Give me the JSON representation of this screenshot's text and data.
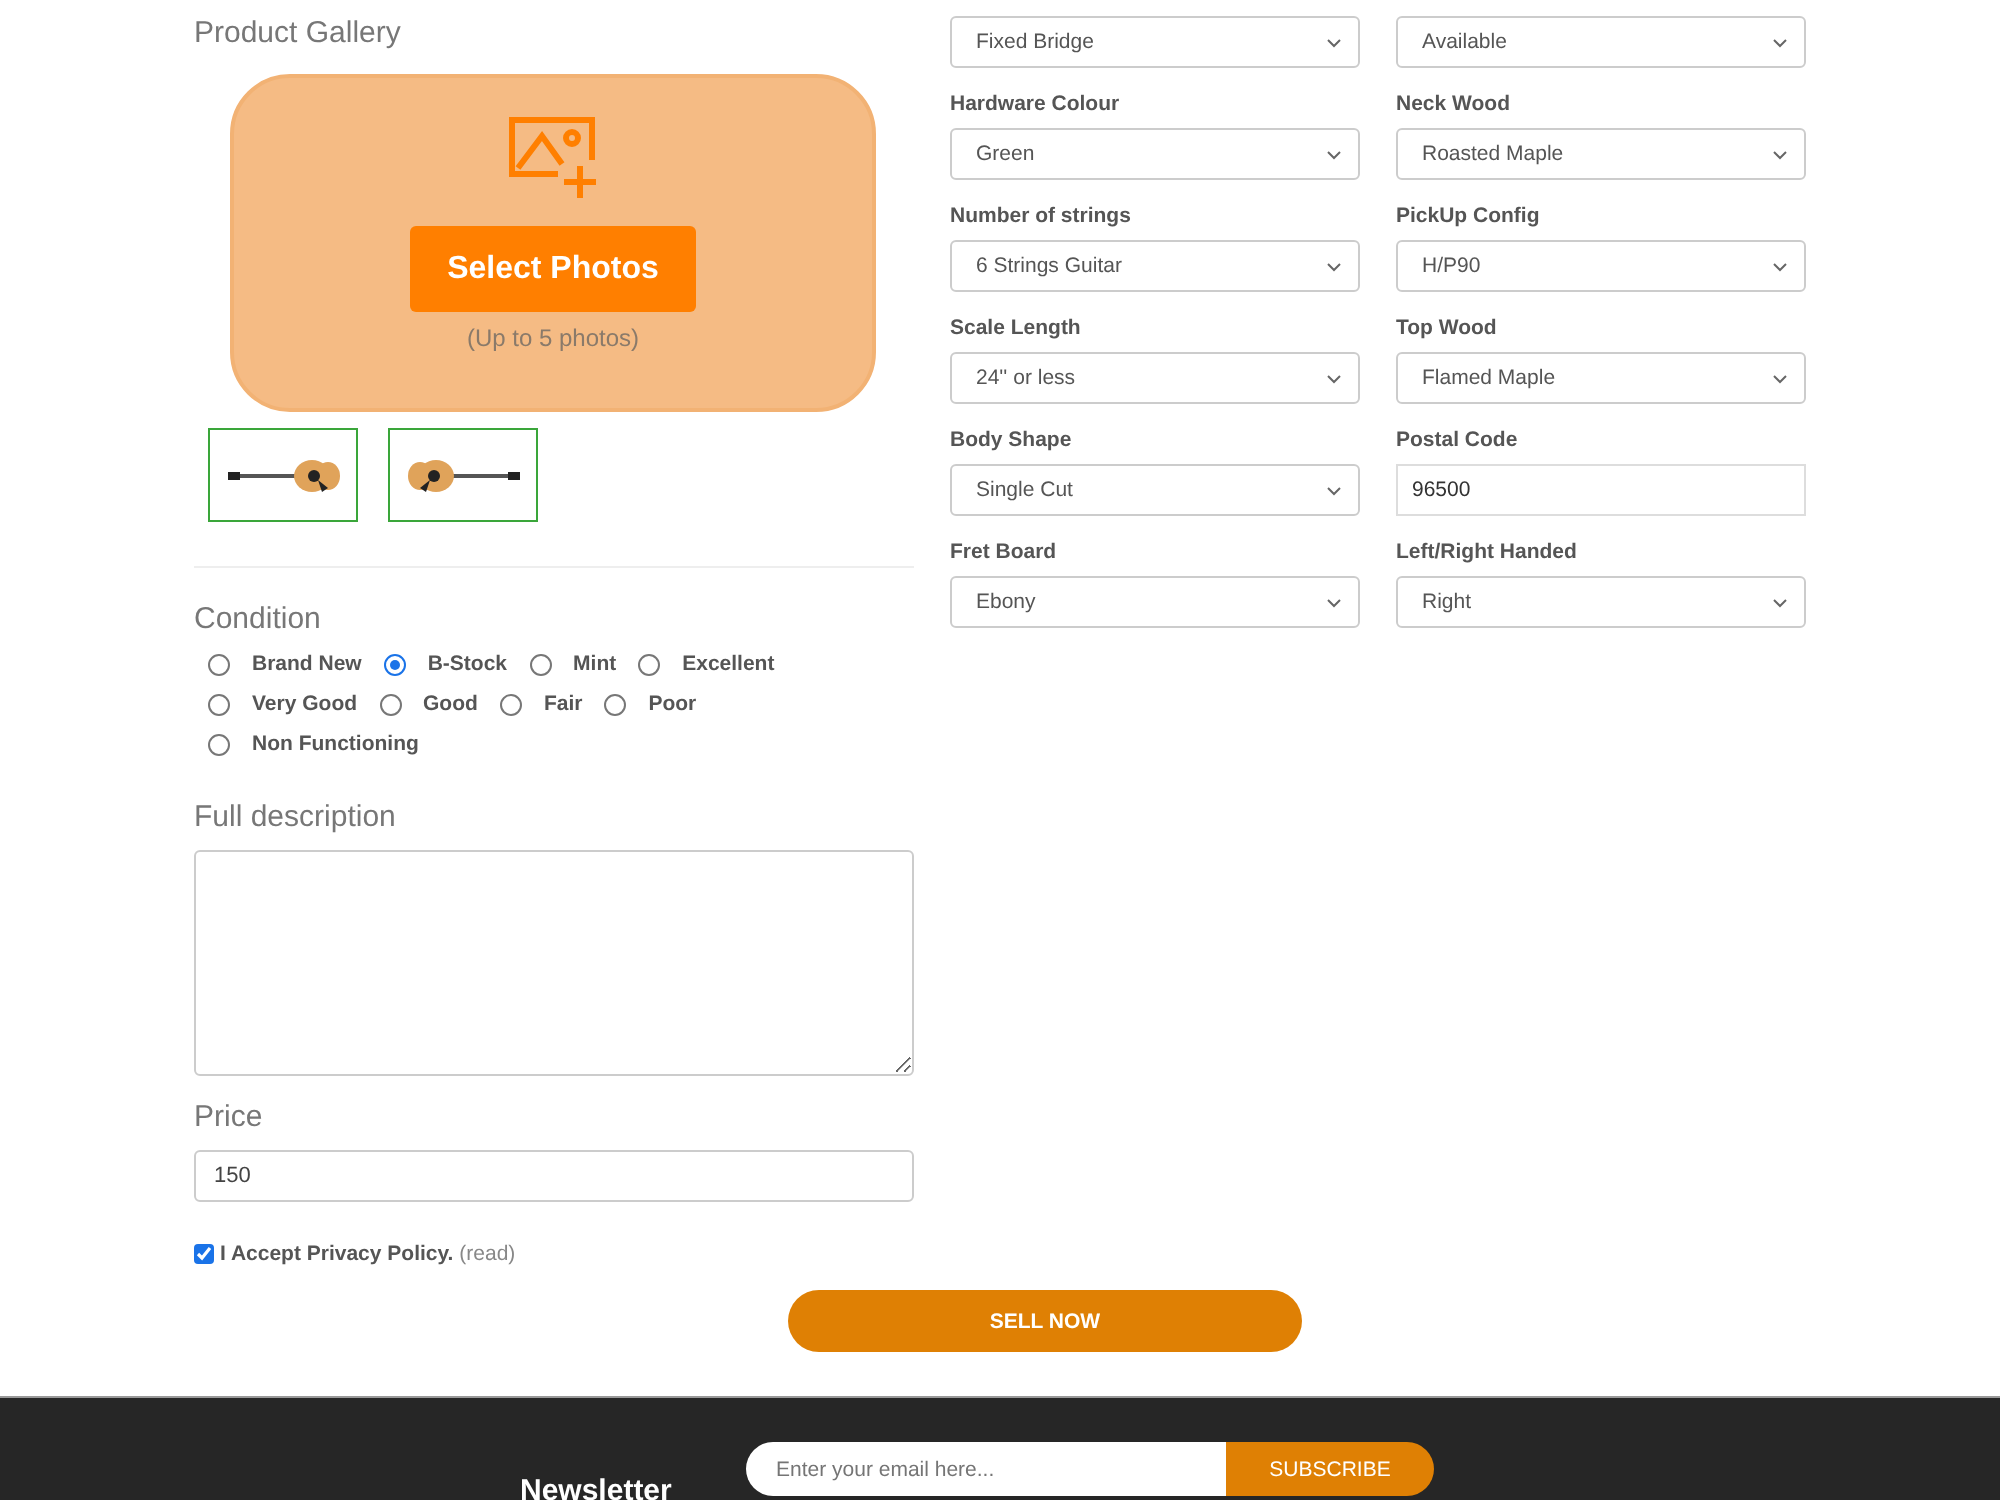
{
  "gallery": {
    "title": "Product Gallery",
    "button": "Select Photos",
    "hint": "(Up to 5 photos)",
    "thumbnails": [
      {
        "kind": "picture",
        "selected": true
      },
      {
        "kind": "picture",
        "selected": true
      }
    ]
  },
  "condition": {
    "title": "Condition",
    "options": [
      {
        "label": "Brand New",
        "selected": false
      },
      {
        "label": "B-Stock",
        "selected": true
      },
      {
        "label": "Mint",
        "selected": false
      },
      {
        "label": "Excellent",
        "selected": false
      },
      {
        "label": "Very Good",
        "selected": false
      },
      {
        "label": "Good",
        "selected": false
      },
      {
        "label": "Fair",
        "selected": false
      },
      {
        "label": "Poor",
        "selected": false
      },
      {
        "label": "Non Functioning",
        "selected": false
      }
    ]
  },
  "description": {
    "title": "Full description"
  },
  "price": {
    "title": "Price",
    "value": "150"
  },
  "privacy": {
    "checked": true,
    "label": "I Accept Privacy Policy.",
    "link": "(read)"
  },
  "fields": [
    {
      "kind": "select",
      "value": "Fixed Bridge"
    },
    {
      "kind": "select",
      "value": "Available"
    },
    {
      "kind": "select",
      "label": "Hardware Colour",
      "value": "Green"
    },
    {
      "kind": "select",
      "label": "Neck Wood",
      "value": "Roasted Maple"
    },
    {
      "kind": "select",
      "label": "Number of strings",
      "value": "6 Strings Guitar"
    },
    {
      "kind": "select",
      "label": "PickUp Config",
      "value": "H/P90"
    },
    {
      "kind": "select",
      "label": "Scale Length",
      "value": "24'' or less"
    },
    {
      "kind": "select",
      "label": "Top Wood",
      "value": "Flamed Maple"
    },
    {
      "kind": "select",
      "label": "Body Shape",
      "value": "Single Cut"
    },
    {
      "kind": "input",
      "label": "Postal Code",
      "value": "96500"
    },
    {
      "kind": "select",
      "label": "Fret Board",
      "value": "Ebony"
    },
    {
      "kind": "select",
      "label": "Left/Right Handed",
      "value": "Right"
    }
  ],
  "submit": "SELL NOW",
  "newsletter": {
    "title": "Newsletter",
    "placeholder": "Enter your email here...",
    "button": "SUBSCRIBE"
  }
}
